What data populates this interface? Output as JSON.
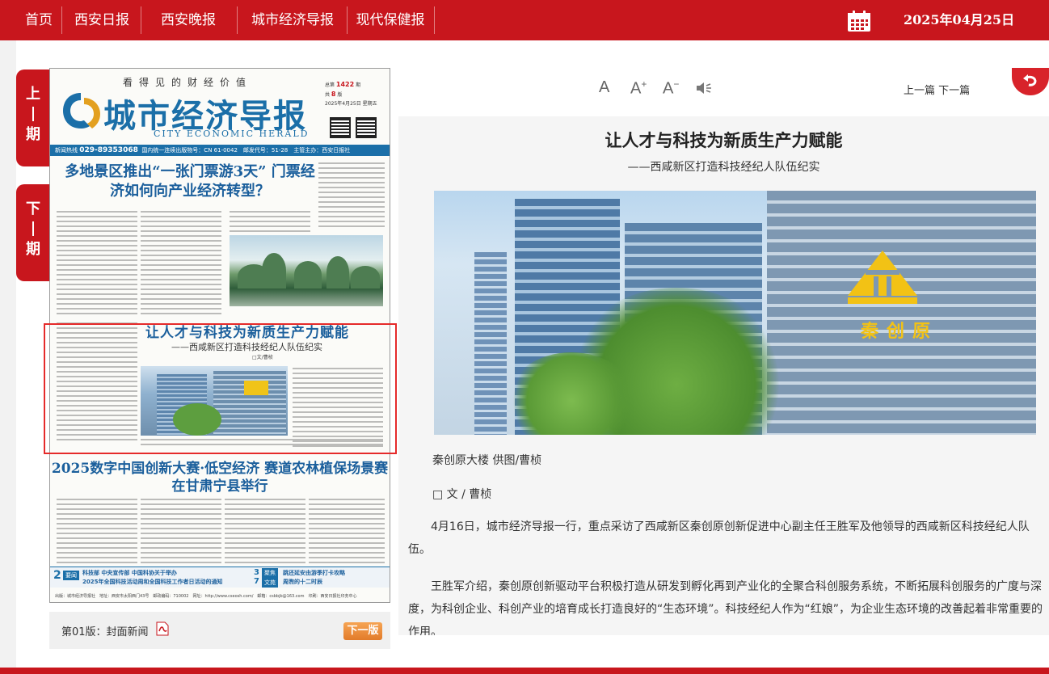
{
  "nav": {
    "items": [
      {
        "label": "首页"
      },
      {
        "label": "西安日报"
      },
      {
        "label": "西安晚报"
      },
      {
        "label": "城市经济导报"
      },
      {
        "label": "现代保健报"
      }
    ],
    "date": "2025年04月25日",
    "calendar_icon": "calendar-icon"
  },
  "side_tabs": {
    "prev": [
      "上",
      "期"
    ],
    "next": [
      "下",
      "期"
    ]
  },
  "paper": {
    "slogan": "看得见的财经价值",
    "title": "城市经济导报",
    "title_en": "CITY ECONOMIC HERALD",
    "issue_total": "1422",
    "issue_pages": "8",
    "issue_date": "2025年4月25日 星期五",
    "hotline": "029-89353068",
    "bar_text": "国内统一连续出版物号：CN 61-0042　邮发代号：51-28　主管主办：西安日报社",
    "hotline_label": "新闻热线",
    "headline1": "多地景区推出“一张门票游3天” 门票经济如何向产业经济转型？",
    "headline2": "让人才与科技为新质生产力赋能",
    "headline2_sub": "——西咸新区打造科技经纪人队伍纪实",
    "headline2_byline": "□文/曹桢",
    "photo2_caption": "秦创原大楼　供图/曹桢",
    "headline3": "2025数字中国创新大赛·低空经济 赛道农林植保场景赛在甘肃宁县举行",
    "bottom_left_num": "2",
    "bottom_left_tag": "要闻",
    "bottom_lines_left": [
      "科技部 中央宣传部 中国科协关于举办",
      "2025年全国科技活动周和全国科技工作者日活动的通知"
    ],
    "bottom_num_3": "3",
    "bottom_num_7": "7",
    "bottom_tag_3": "聚焦",
    "bottom_tag_7": "文苑",
    "bottom_lines_right": [
      "跳还延安由游季打卡攻略",
      "周煦的十二时辰"
    ],
    "footer": "出版：城市经济导报社　地址：西安市太阳西门43号　邮政编码：710002　网址：http://www.cseosh.com/　邮箱：csbbjb@163.com　印刷：西安日报社印务中心"
  },
  "page_footer": {
    "label": "第01版：封面新闻",
    "next_button": "下一版"
  },
  "toolbar": {
    "font_normal": "A",
    "font_larger": "A",
    "font_larger_sup": "+",
    "font_smaller": "A",
    "font_smaller_sup": "−",
    "prev_article": "上一篇",
    "next_article": "下一篇"
  },
  "article": {
    "title": "让人才与科技为新质生产力赋能",
    "subtitle": "——西咸新区打造科技经纪人队伍纪实",
    "photo_sign": "秦创原",
    "caption": "秦创原大楼 供图/曹桢",
    "byline": "□ 文 / 曹桢",
    "paragraphs": [
      "4月16日，城市经济导报一行，重点采访了西咸新区秦创原创新促进中心副主任王胜军及他领导的西咸新区科技经纪人队伍。",
      "王胜军介绍，秦创原创新驱动平台积极打造从研发到孵化再到产业化的全聚合科创服务系统，不断拓展科创服务的广度与深度，为科创企业、科创产业的培育成长打造良好的“生态环境”。科技经纪人作为“红娘”，为企业生态环境的改善起着非常重要的作用。"
    ]
  },
  "colors": {
    "brand_red": "#c8161d",
    "paper_blue": "#1b6fa8",
    "highlight_red": "#e52a2a",
    "next_button_orange": "#e27b2a"
  }
}
